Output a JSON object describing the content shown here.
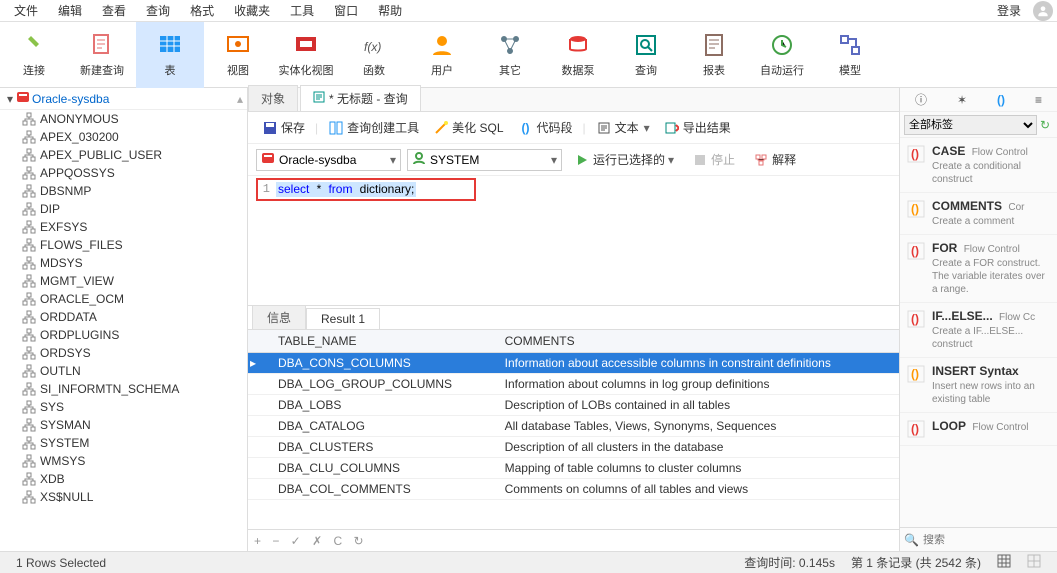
{
  "menus": [
    "文件",
    "编辑",
    "查看",
    "查询",
    "格式",
    "收藏夹",
    "工具",
    "窗口",
    "帮助"
  ],
  "login_label": "登录",
  "toolbar": [
    {
      "label": "连接",
      "icon": "plug",
      "color": "#8bc34a"
    },
    {
      "label": "新建查询",
      "icon": "doc",
      "color": "#e57373"
    },
    {
      "label": "表",
      "icon": "table",
      "color": "#2196f3",
      "active": true
    },
    {
      "label": "视图",
      "icon": "view",
      "color": "#ef6c00"
    },
    {
      "label": "实体化视图",
      "icon": "mview",
      "color": "#d32f2f"
    },
    {
      "label": "函数",
      "icon": "fx",
      "color": "#555"
    },
    {
      "label": "用户",
      "icon": "user",
      "color": "#ff9800"
    },
    {
      "label": "其它",
      "icon": "misc",
      "color": "#607d8b"
    },
    {
      "label": "数据泵",
      "icon": "pump",
      "color": "#e53935"
    },
    {
      "label": "查询",
      "icon": "query",
      "color": "#00897b"
    },
    {
      "label": "报表",
      "icon": "report",
      "color": "#8d6e63"
    },
    {
      "label": "自动运行",
      "icon": "auto",
      "color": "#43a047"
    },
    {
      "label": "模型",
      "icon": "model",
      "color": "#5c6bc0"
    }
  ],
  "sidebar": {
    "connection": "Oracle-sysdba",
    "items": [
      "ANONYMOUS",
      "APEX_030200",
      "APEX_PUBLIC_USER",
      "APPQOSSYS",
      "DBSNMP",
      "DIP",
      "EXFSYS",
      "FLOWS_FILES",
      "MDSYS",
      "MGMT_VIEW",
      "ORACLE_OCM",
      "ORDDATA",
      "ORDPLUGINS",
      "ORDSYS",
      "OUTLN",
      "SI_INFORMTN_SCHEMA",
      "SYS",
      "SYSMAN",
      "SYSTEM",
      "WMSYS",
      "XDB",
      "XS$NULL"
    ]
  },
  "tabs": {
    "obj": "对象",
    "query": "* 无标题 - 查询"
  },
  "subtoolbar": {
    "save": "保存",
    "builder": "查询创建工具",
    "beautify": "美化 SQL",
    "snippet": "代码段",
    "text": "文本",
    "export": "导出结果"
  },
  "conn": {
    "db": "Oracle-sysdba",
    "schema": "SYSTEM",
    "run": "运行已选择的",
    "stop": "停止",
    "explain": "解释"
  },
  "sql": {
    "line": "1",
    "select": "select",
    "star": "*",
    "from": "from",
    "tbl": "dictionary;"
  },
  "result_tabs": {
    "info": "信息",
    "r1": "Result 1"
  },
  "grid": {
    "cols": [
      "TABLE_NAME",
      "COMMENTS"
    ],
    "rows": [
      {
        "t": "DBA_CONS_COLUMNS",
        "c": "Information about accessible columns in constraint definitions",
        "sel": true
      },
      {
        "t": "DBA_LOG_GROUP_COLUMNS",
        "c": "Information about columns in log group definitions"
      },
      {
        "t": "DBA_LOBS",
        "c": "Description of LOBs contained in all tables"
      },
      {
        "t": "DBA_CATALOG",
        "c": "All database Tables, Views, Synonyms, Sequences"
      },
      {
        "t": "DBA_CLUSTERS",
        "c": "Description of all clusters in the database"
      },
      {
        "t": "DBA_CLU_COLUMNS",
        "c": "Mapping of table columns to cluster columns"
      },
      {
        "t": "DBA_COL_COMMENTS",
        "c": "Comments on columns of all tables and views"
      }
    ],
    "footer_nav": "+  −  ✓  ✗  C  ↻"
  },
  "snippets": {
    "filter": "全部标签",
    "items": [
      {
        "t": "CASE",
        "s": "Flow Control",
        "d": "Create a conditional construct",
        "c": "#e53935"
      },
      {
        "t": "COMMENTS",
        "s": "Cor",
        "d": "Create a comment",
        "c": "#ff9800"
      },
      {
        "t": "FOR",
        "s": "Flow Control",
        "d": "Create a FOR construct. The variable iterates over a range.",
        "c": "#e53935"
      },
      {
        "t": "IF...ELSE...",
        "s": "Flow Cc",
        "d": "Create a IF...ELSE... construct",
        "c": "#e53935"
      },
      {
        "t": "INSERT Syntax",
        "s": "",
        "d": "Insert new rows into an existing table",
        "c": "#ff9800"
      },
      {
        "t": "LOOP",
        "s": "Flow Control",
        "d": "",
        "c": "#e53935"
      }
    ],
    "search_ph": "搜索"
  },
  "status": {
    "rows": "1 Rows Selected",
    "time": "查询时间: 0.145s",
    "pager": "第 1 条记录 (共 2542 条)"
  }
}
